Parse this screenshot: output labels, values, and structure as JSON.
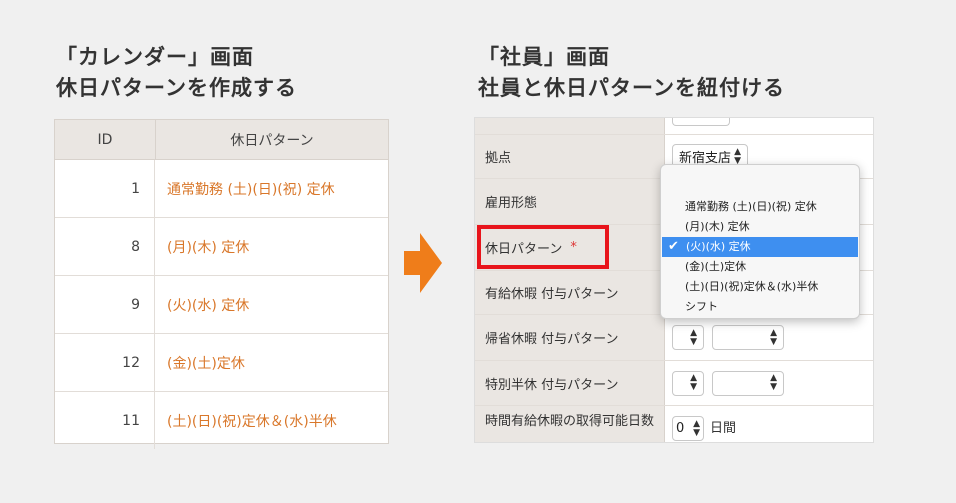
{
  "left_heading": {
    "line1": "「カレンダー」画面",
    "line2": "休日パターンを作成する"
  },
  "right_heading": {
    "line1": "「社員」画面",
    "line2": "社員と休日パターンを紐付ける"
  },
  "calendar_table": {
    "columns": [
      "ID",
      "休日パターン"
    ],
    "rows": [
      {
        "id": "1",
        "pattern": "通常勤務 (土)(日)(祝) 定休"
      },
      {
        "id": "8",
        "pattern": "(月)(木) 定休"
      },
      {
        "id": "9",
        "pattern": "(火)(水) 定休"
      },
      {
        "id": "12",
        "pattern": "(金)(土)定休"
      },
      {
        "id": "11",
        "pattern": "(土)(日)(祝)定休＆(水)半休"
      }
    ]
  },
  "employee_form": {
    "fields": {
      "base_label": "拠点",
      "base_value": "新宿支店",
      "employment_label": "雇用形態",
      "holiday_label": "休日パターン",
      "required_mark": "*",
      "paid_leave_label": "有給休暇 付与パターン",
      "home_leave_label": "帰省休暇 付与パターン",
      "special_half_label": "特別半休 付与パターン",
      "hourly_leave_label": "時間有給休暇の取得可能日数",
      "hourly_leave_value": "0",
      "hourly_leave_unit": "日間"
    },
    "dropdown": {
      "options": [
        "通常勤務 (土)(日)(祝) 定休",
        "(月)(木) 定休",
        "(火)(水) 定休",
        "(金)(土)定休",
        "(土)(日)(祝)定休＆(水)半休",
        "シフト"
      ],
      "selected": "(火)(水) 定休",
      "selected_index": 2
    }
  },
  "colors": {
    "accent_orange": "#d9772a",
    "arrow_orange": "#ef7d1a",
    "highlight_red": "#e8141b",
    "selected_blue": "#3e8ff0",
    "header_bg": "#eae6e2"
  },
  "icons": {
    "arrow": "right-arrow-icon",
    "check": "checkmark-icon"
  }
}
